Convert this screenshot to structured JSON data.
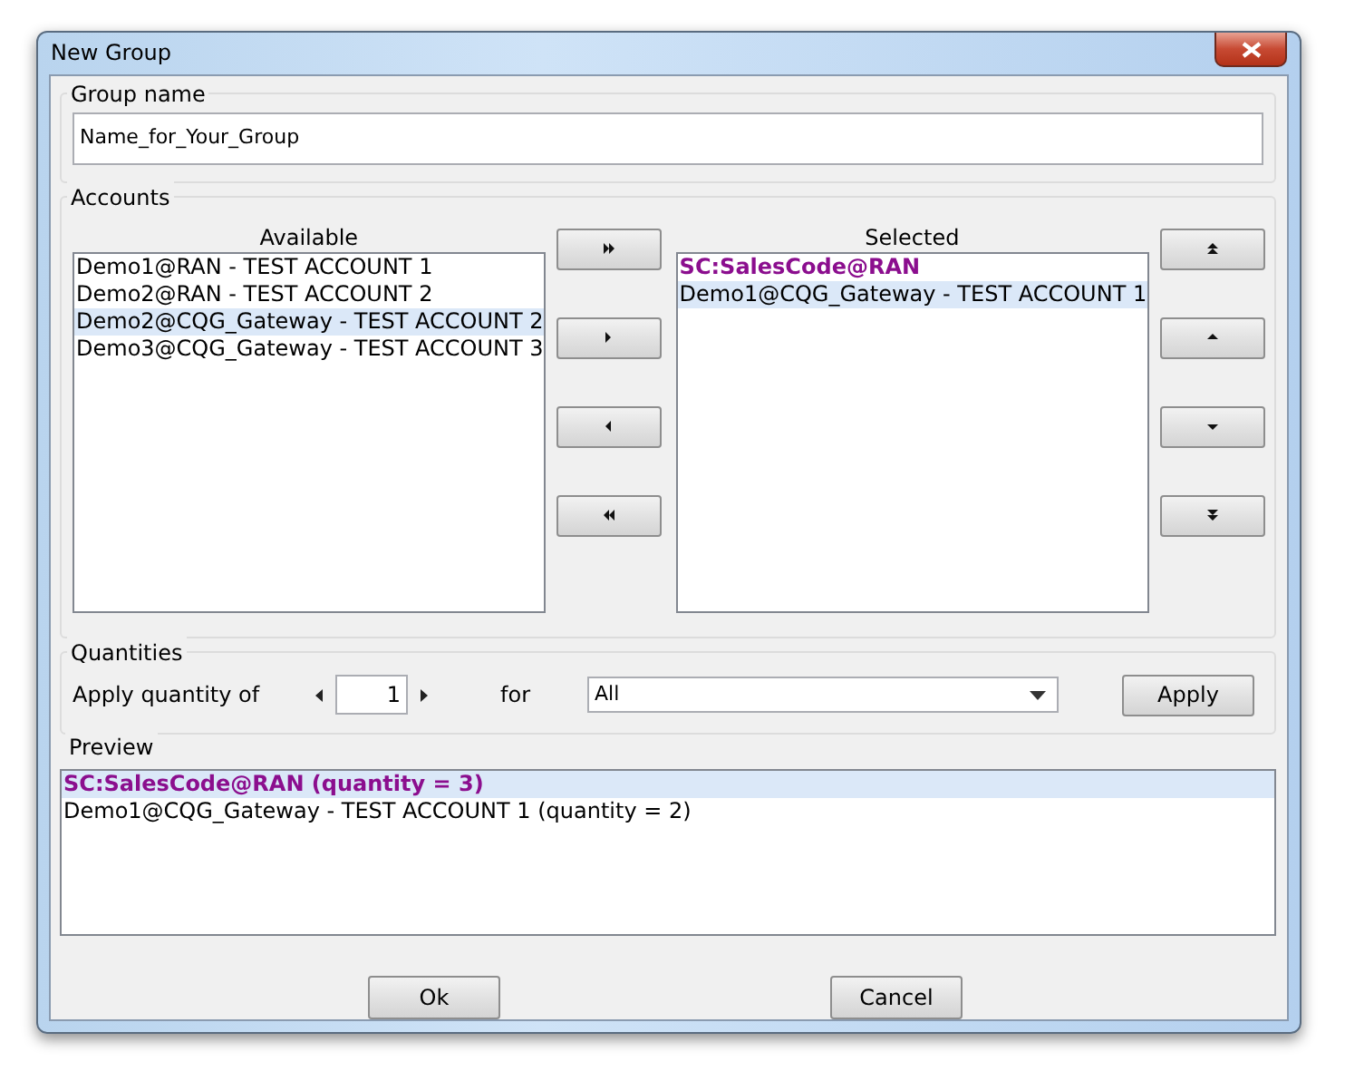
{
  "window": {
    "title": "New Group"
  },
  "group_name": {
    "label": "Group name",
    "value": "Name_for_Your_Group"
  },
  "accounts": {
    "label": "Accounts",
    "available": {
      "header": "Available",
      "items": [
        {
          "text": "Demo1@RAN - TEST ACCOUNT 1",
          "kind": "account",
          "selected": false
        },
        {
          "text": "Demo2@RAN - TEST ACCOUNT 2",
          "kind": "account",
          "selected": false
        },
        {
          "text": "Demo2@CQG_Gateway - TEST ACCOUNT 2",
          "kind": "account",
          "selected": true
        },
        {
          "text": "Demo3@CQG_Gateway - TEST ACCOUNT 3",
          "kind": "account",
          "selected": false
        }
      ]
    },
    "selected": {
      "header": "Selected",
      "items": [
        {
          "text": "SC:SalesCode@RAN",
          "kind": "sales_code",
          "selected": false
        },
        {
          "text": "Demo1@CQG_Gateway - TEST ACCOUNT 1",
          "kind": "account",
          "selected": true
        }
      ]
    }
  },
  "quantities": {
    "label": "Quantities",
    "apply_label": "Apply quantity of",
    "quantity": "1",
    "for_label": "for",
    "for_value": "All",
    "apply_button": "Apply"
  },
  "preview": {
    "label": "Preview",
    "items": [
      {
        "text": "SC:SalesCode@RAN (quantity = 3)",
        "kind": "sales_code",
        "selected": true
      },
      {
        "text": "Demo1@CQG_Gateway - TEST ACCOUNT 1 (quantity = 2)",
        "kind": "account",
        "selected": false
      }
    ]
  },
  "buttons": [
    "Ok",
    "Cancel"
  ]
}
